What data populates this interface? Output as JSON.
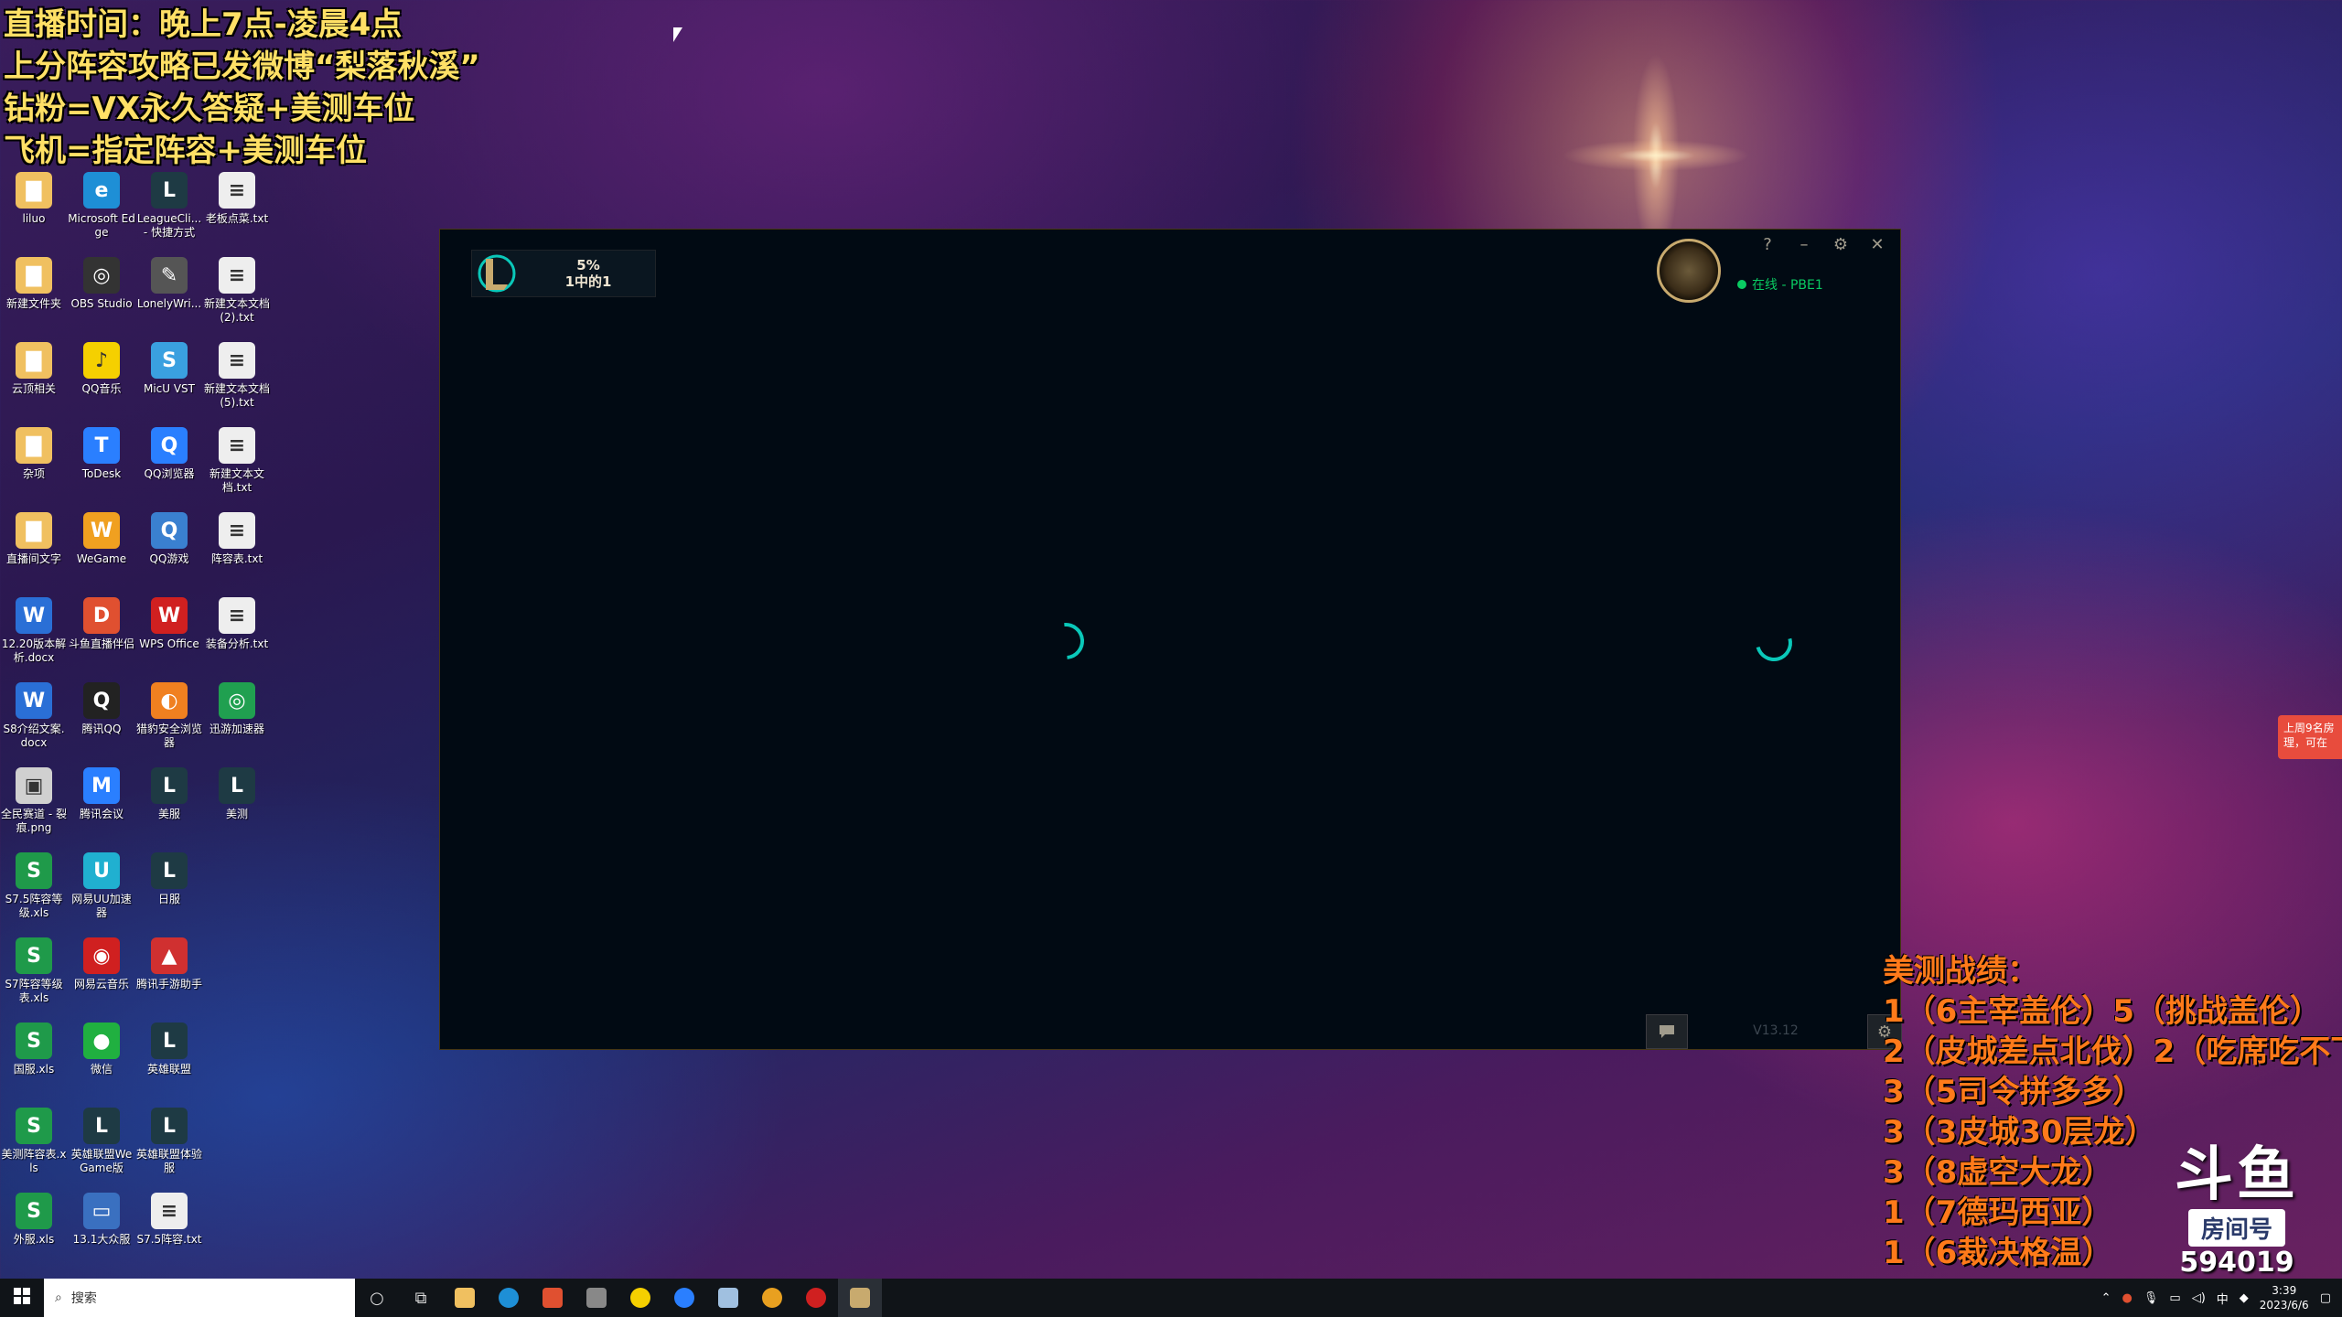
{
  "overlay": {
    "lines": [
      "直播时间：晚上7点-凌晨4点",
      "上分阵容攻略已发微博“梨落秋溪”",
      "钻粉=VX永久答疑+美测车位",
      "飞机=指定阵容+美测车位"
    ]
  },
  "desktop": {
    "icons": [
      {
        "label": "liluo",
        "color": "#f0c060",
        "glyph": "▇"
      },
      {
        "label": "Microsoft Edge",
        "color": "#1e8fd6",
        "glyph": "e"
      },
      {
        "label": "LeagueCli... - 快捷方式",
        "color": "#1e3a44",
        "glyph": "L"
      },
      {
        "label": "老板点菜.txt",
        "color": "#eeeeee",
        "glyph": "≡"
      },
      {
        "label": "新建文件夹",
        "color": "#f0c060",
        "glyph": "▇"
      },
      {
        "label": "OBS Studio",
        "color": "#333333",
        "glyph": "◎"
      },
      {
        "label": "LonelyWri...",
        "color": "#555555",
        "glyph": "✎"
      },
      {
        "label": "新建文本文档 (2).txt",
        "color": "#eeeeee",
        "glyph": "≡"
      },
      {
        "label": "云顶相关",
        "color": "#f0c060",
        "glyph": "▇"
      },
      {
        "label": "QQ音乐",
        "color": "#f5d000",
        "glyph": "♪"
      },
      {
        "label": "MicU VST",
        "color": "#3aa0e0",
        "glyph": "S"
      },
      {
        "label": "新建文本文档 (5).txt",
        "color": "#eeeeee",
        "glyph": "≡"
      },
      {
        "label": "杂项",
        "color": "#f0c060",
        "glyph": "▇"
      },
      {
        "label": "ToDesk",
        "color": "#2a7fff",
        "glyph": "T"
      },
      {
        "label": "QQ浏览器",
        "color": "#2a7fff",
        "glyph": "Q"
      },
      {
        "label": "新建文本文档.txt",
        "color": "#eeeeee",
        "glyph": "≡"
      },
      {
        "label": "直播间文字",
        "color": "#f0c060",
        "glyph": "▇"
      },
      {
        "label": "WeGame",
        "color": "#f0a020",
        "glyph": "W"
      },
      {
        "label": "QQ游戏",
        "color": "#3a80d0",
        "glyph": "Q"
      },
      {
        "label": "阵容表.txt",
        "color": "#eeeeee",
        "glyph": "≡"
      },
      {
        "label": "12.20版本解析.docx",
        "color": "#2a6fd6",
        "glyph": "W"
      },
      {
        "label": "斗鱼直播伴侣",
        "color": "#e05030",
        "glyph": "D"
      },
      {
        "label": "WPS Office",
        "color": "#d02020",
        "glyph": "W"
      },
      {
        "label": "装备分析.txt",
        "color": "#eeeeee",
        "glyph": "≡"
      },
      {
        "label": "S8介绍文案.docx",
        "color": "#2a6fd6",
        "glyph": "W"
      },
      {
        "label": "腾讯QQ",
        "color": "#222222",
        "glyph": "Q"
      },
      {
        "label": "猎豹安全浏览器",
        "color": "#f08020",
        "glyph": "◐"
      },
      {
        "label": "迅游加速器",
        "color": "#20a050",
        "glyph": "◎"
      },
      {
        "label": "全民赛道 - 裂痕.png",
        "color": "#d0d0d0",
        "glyph": "▣"
      },
      {
        "label": "腾讯会议",
        "color": "#2a7fff",
        "glyph": "M"
      },
      {
        "label": "美服",
        "color": "#1e3a44",
        "glyph": "L"
      },
      {
        "label": "美测",
        "color": "#1e3a44",
        "glyph": "L"
      },
      {
        "label": "S7.5阵容等级.xls",
        "color": "#1f9a4a",
        "glyph": "S"
      },
      {
        "label": "网易UU加速器",
        "color": "#20b0d0",
        "glyph": "U"
      },
      {
        "label": "日服",
        "color": "#1e3a44",
        "glyph": "L"
      },
      {
        "label": "",
        "color": "",
        "glyph": ""
      },
      {
        "label": "S7阵容等级表.xls",
        "color": "#1f9a4a",
        "glyph": "S"
      },
      {
        "label": "网易云音乐",
        "color": "#d02020",
        "glyph": "◉"
      },
      {
        "label": "腾讯手游助手",
        "color": "#d03030",
        "glyph": "▲"
      },
      {
        "label": "",
        "color": "",
        "glyph": ""
      },
      {
        "label": "国服.xls",
        "color": "#1f9a4a",
        "glyph": "S"
      },
      {
        "label": "微信",
        "color": "#20b040",
        "glyph": "●"
      },
      {
        "label": "英雄联盟",
        "color": "#1e3a44",
        "glyph": "L"
      },
      {
        "label": "",
        "color": "",
        "glyph": ""
      },
      {
        "label": "美测阵容表.xls",
        "color": "#1f9a4a",
        "glyph": "S"
      },
      {
        "label": "英雄联盟WeGame版",
        "color": "#1e3a44",
        "glyph": "L"
      },
      {
        "label": "英雄联盟体验服",
        "color": "#1e3a44",
        "glyph": "L"
      },
      {
        "label": "",
        "color": "",
        "glyph": ""
      },
      {
        "label": "外服.xls",
        "color": "#1f9a4a",
        "glyph": "S"
      },
      {
        "label": "13.1大众服",
        "color": "#3a70c0",
        "glyph": "▭"
      },
      {
        "label": "S7.5阵容.txt",
        "color": "#eeeeee",
        "glyph": "≡"
      }
    ]
  },
  "client": {
    "progress_percent": "5%",
    "progress_sub": "1中的1",
    "status_text": "在线 - PBE1",
    "version": "V13.12",
    "controls": {
      "help": "?",
      "minimize": "–",
      "settings": "⚙",
      "close": "✕"
    },
    "accent": "#0ac8b9",
    "gold": "#c8aa6e"
  },
  "record": {
    "title": "美测战绩：",
    "lines": [
      "1（6主宰盖伦）5（挑战盖伦）",
      "2（皮城差点北伐）2（吃席吃不下",
      "3（5司令拼多多）",
      "3（3皮城30层龙）",
      "3（8虚空大龙）",
      "1（7德玛西亚）",
      "1（6裁决格温）"
    ]
  },
  "douyu": {
    "logo": "斗鱼",
    "room_label": "房间号",
    "room_number": "594019"
  },
  "toast": {
    "line1": "上周9名房",
    "line2": "理，可在"
  },
  "taskbar": {
    "search_placeholder": "搜索",
    "time": "3:39",
    "date": "2023/6/6",
    "ime": "中"
  }
}
